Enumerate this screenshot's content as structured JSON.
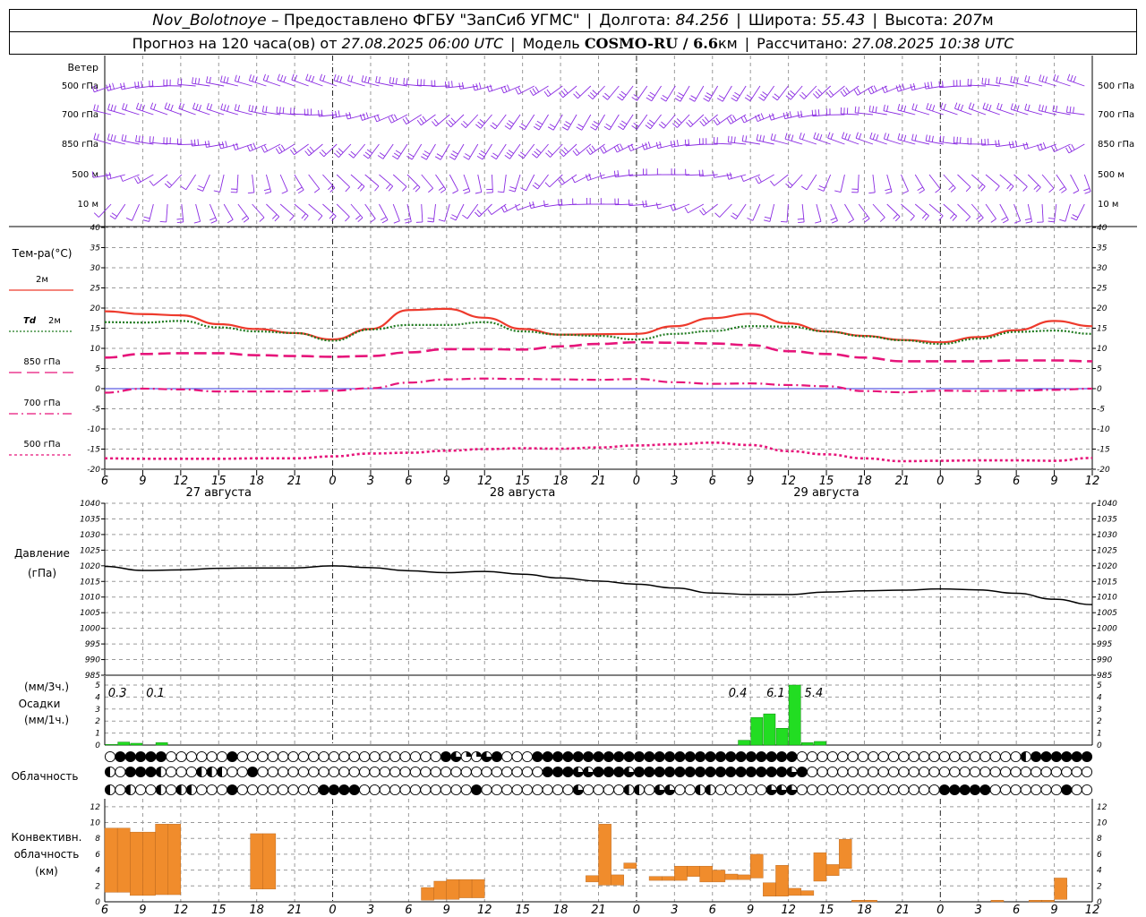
{
  "header": {
    "station": "Nov_Bolotnoye",
    "provider": "– Предоставлено ФГБУ \"ЗапСиб УГМС\"",
    "lon_label": "Долгота:",
    "lon_value": "84.256",
    "lat_label": "Широта:",
    "lat_value": "55.43",
    "alt_label": "Высота:",
    "alt_value": "207",
    "alt_unit": "м",
    "forecast_prefix": "Прогноз на 120 часа(ов) от",
    "forecast_time": "27.08.2025 06:00 UTC",
    "model_label": "Модель",
    "model_name": "COSMO-RU / 6.6",
    "model_unit": "км",
    "calc_label": "Рассчитано:",
    "calc_time": "27.08.2025 10:38 UTC"
  },
  "colors": {
    "wind": "#8a2be2",
    "t2m": "#ee3a2c",
    "td2m": "#1e7a1e",
    "t850": "#e6157a",
    "t700": "#e6157a",
    "t500": "#e6157a",
    "pressure": "#000000",
    "precip": "#22dd22",
    "convective": "#f08c2c",
    "grid": "#9a9a9a",
    "zero_line": "#3333dd"
  },
  "chart_data": [
    {
      "type": "wind_barbs",
      "panel_label": "Ветер",
      "levels": [
        "500 гПа",
        "700 гПа",
        "850 гПа",
        "500 м",
        "10 м"
      ]
    },
    {
      "type": "line",
      "panel_label": "Тем-ра(°C)",
      "ylim": [
        -20,
        40
      ],
      "yticks": [
        -20,
        -15,
        -10,
        -5,
        0,
        5,
        10,
        15,
        20,
        25,
        30,
        35,
        40
      ],
      "x_ticks": [
        "6",
        "9",
        "12",
        "15",
        "18",
        "21",
        "0",
        "3",
        "6",
        "9",
        "12",
        "15",
        "18",
        "21",
        "0",
        "3",
        "6",
        "9",
        "12",
        "15",
        "18",
        "21",
        "0",
        "3",
        "6",
        "9",
        "12"
      ],
      "dates": [
        "27 августа",
        "28 августа",
        "29 августа"
      ],
      "x_hours": [
        0,
        3,
        6,
        9,
        12,
        15,
        18,
        21,
        24,
        27,
        30,
        33,
        36,
        39,
        42,
        45,
        48,
        51,
        54,
        57,
        60,
        63,
        66,
        69,
        72,
        75,
        78
      ],
      "series": [
        {
          "name": "2м",
          "legend_prefix": "",
          "style": "solid",
          "values": [
            19.2,
            18.5,
            18.2,
            16,
            14.8,
            13.8,
            12.2,
            14.8,
            19.5,
            19.8,
            17.6,
            14.8,
            13.4,
            13.5,
            13.6,
            15.5,
            17.5,
            18.6,
            16.2,
            14.2,
            13.1,
            12.1,
            11.5,
            12.8,
            14.5,
            16.8,
            15.5
          ]
        },
        {
          "name": "2м",
          "legend_prefix": "Td",
          "style": "dotted",
          "values": [
            16.5,
            16.4,
            16.8,
            15.2,
            14.2,
            13.8,
            11.9,
            14.7,
            15.8,
            15.8,
            16.5,
            14.2,
            13.4,
            13.1,
            12.2,
            13.6,
            14.3,
            15.5,
            15.4,
            14.2,
            13,
            12,
            11.1,
            12.4,
            14.1,
            14.4,
            13.6
          ]
        },
        {
          "name": "850 гПа",
          "legend_prefix": "",
          "style": "dashed",
          "values": [
            7.7,
            8.6,
            8.8,
            8.8,
            8.3,
            8.1,
            7.9,
            8.1,
            9,
            9.8,
            9.8,
            9.7,
            10.5,
            11.1,
            11.5,
            11.4,
            11.2,
            10.8,
            9.3,
            8.6,
            7.7,
            6.8,
            6.8,
            6.8,
            7,
            7,
            6.8
          ]
        },
        {
          "name": "700 гПа",
          "legend_prefix": "",
          "style": "dashdot",
          "values": [
            -1,
            0,
            -0.2,
            -0.7,
            -0.7,
            -0.7,
            -0.5,
            0.1,
            1.5,
            2.3,
            2.5,
            2.4,
            2.3,
            2.2,
            2.4,
            1.6,
            1.2,
            1.3,
            0.9,
            0.6,
            -0.6,
            -0.9,
            -0.5,
            -0.6,
            -0.5,
            -0.3,
            0
          ]
        },
        {
          "name": "500 гПа",
          "legend_prefix": "",
          "style": "dotted-fine",
          "values": [
            -17.3,
            -17.4,
            -17.4,
            -17.4,
            -17.3,
            -17.3,
            -16.8,
            -16.1,
            -15.9,
            -15.4,
            -15,
            -14.8,
            -14.9,
            -14.6,
            -14.1,
            -13.8,
            -13.4,
            -14,
            -15.5,
            -16.3,
            -17.3,
            -18,
            -17.9,
            -17.8,
            -17.8,
            -17.9,
            -17.2
          ]
        }
      ]
    },
    {
      "type": "line",
      "panel_label": "Давление",
      "panel_unit": "(гПа)",
      "ylim": [
        985,
        1040
      ],
      "yticks": [
        985,
        990,
        995,
        1000,
        1005,
        1010,
        1015,
        1020,
        1025,
        1030,
        1035,
        1040
      ],
      "x_hours": [
        0,
        3,
        6,
        9,
        12,
        15,
        18,
        21,
        24,
        27,
        30,
        33,
        36,
        39,
        42,
        45,
        48,
        51,
        54,
        57,
        60,
        63,
        66,
        69,
        72,
        75,
        78
      ],
      "series": [
        {
          "name": "",
          "values": [
            1019.8,
            1018.5,
            1018.7,
            1019.2,
            1019.3,
            1019.3,
            1020,
            1019.4,
            1018.4,
            1017.8,
            1018.2,
            1017.3,
            1016.1,
            1015.1,
            1014.1,
            1012.9,
            1011.3,
            1010.8,
            1010.8,
            1011.6,
            1012,
            1012.2,
            1012.6,
            1012.3,
            1011.2,
            1009.3,
            1007.6
          ]
        }
      ]
    },
    {
      "type": "bar",
      "panel_label": "Осадки",
      "units_top": "(мм/3ч.)",
      "units_bottom": "(мм/1ч.)",
      "ylim": [
        0,
        5
      ],
      "yticks": [
        0,
        1,
        2,
        3,
        4,
        5
      ],
      "bars": [
        {
          "h": 1,
          "v": 0.05
        },
        {
          "h": 2,
          "v": 0.25
        },
        {
          "h": 3,
          "v": 0.15
        },
        {
          "h": 5,
          "v": 0.2
        },
        {
          "h": 51,
          "v": 0.4
        },
        {
          "h": 52,
          "v": 2.3
        },
        {
          "h": 53,
          "v": 2.6
        },
        {
          "h": 54,
          "v": 1.4
        },
        {
          "h": 55,
          "v": 5.0
        },
        {
          "h": 56,
          "v": 0.2
        },
        {
          "h": 57,
          "v": 0.3
        }
      ],
      "totals": [
        {
          "h": 1.5,
          "text": "0.3"
        },
        {
          "h": 4.5,
          "text": "0.1"
        },
        {
          "h": 50.5,
          "text": "0.4"
        },
        {
          "h": 53.5,
          "text": "6.1"
        },
        {
          "h": 56.5,
          "text": "5.4"
        }
      ]
    },
    {
      "type": "cloud_symbols",
      "panel_label": "Облачность",
      "rows": [
        "0444440000004000000000000000000004311340004444444444444444444444444400000000000000000000002444444",
        "2044420002220040000000000000000000000000000444334443444444444444444340000000000000000000000000000",
        "2020020220004000000004444000000000004000000000300002203300220000033300000000000000444440000000400"
      ]
    },
    {
      "type": "range_bar",
      "panel_label": "Конвективн. облачность (км)",
      "ylim": [
        0,
        13
      ],
      "yticks": [
        0,
        2,
        4,
        6,
        8,
        10,
        12
      ],
      "bars": [
        {
          "h": 0.5,
          "lo": 1.2,
          "hi": 9.3
        },
        {
          "h": 1.5,
          "lo": 1.2,
          "hi": 9.3
        },
        {
          "h": 2.5,
          "lo": 0.8,
          "hi": 8.8
        },
        {
          "h": 3.5,
          "lo": 0.8,
          "hi": 8.8
        },
        {
          "h": 4.5,
          "lo": 0.9,
          "hi": 9.8
        },
        {
          "h": 5.5,
          "lo": 0.9,
          "hi": 9.8
        },
        {
          "h": 12,
          "lo": 1.6,
          "hi": 8.6
        },
        {
          "h": 13,
          "lo": 1.6,
          "hi": 8.6
        },
        {
          "h": 25.5,
          "lo": 0.2,
          "hi": 1.8
        },
        {
          "h": 26.5,
          "lo": 0.3,
          "hi": 2.6
        },
        {
          "h": 27.5,
          "lo": 0.3,
          "hi": 2.8
        },
        {
          "h": 28.5,
          "lo": 0.5,
          "hi": 2.8
        },
        {
          "h": 29.5,
          "lo": 0.5,
          "hi": 2.8
        },
        {
          "h": 38.5,
          "lo": 2.5,
          "hi": 3.3
        },
        {
          "h": 39.5,
          "lo": 2.1,
          "hi": 9.8
        },
        {
          "h": 40.5,
          "lo": 2.1,
          "hi": 3.4
        },
        {
          "h": 41.5,
          "lo": 4.2,
          "hi": 4.9
        },
        {
          "h": 43.5,
          "lo": 2.7,
          "hi": 3.2
        },
        {
          "h": 44.5,
          "lo": 2.7,
          "hi": 3.2
        },
        {
          "h": 45.5,
          "lo": 2.7,
          "hi": 4.5
        },
        {
          "h": 46.5,
          "lo": 3.2,
          "hi": 4.5
        },
        {
          "h": 47.5,
          "lo": 2.5,
          "hi": 4.5
        },
        {
          "h": 48.5,
          "lo": 2.5,
          "hi": 4.0
        },
        {
          "h": 49.5,
          "lo": 2.8,
          "hi": 3.5
        },
        {
          "h": 50.5,
          "lo": 2.8,
          "hi": 3.4
        },
        {
          "h": 51.5,
          "lo": 3.0,
          "hi": 6.0
        },
        {
          "h": 52.5,
          "lo": 0.7,
          "hi": 2.4
        },
        {
          "h": 53.5,
          "lo": 0.7,
          "hi": 4.6
        },
        {
          "h": 54.5,
          "lo": 0.8,
          "hi": 1.7
        },
        {
          "h": 55.5,
          "lo": 0.8,
          "hi": 1.4
        },
        {
          "h": 56.5,
          "lo": 2.6,
          "hi": 6.2
        },
        {
          "h": 57.5,
          "lo": 3.3,
          "hi": 4.7
        },
        {
          "h": 58.5,
          "lo": 4.2,
          "hi": 7.9
        },
        {
          "h": 59.5,
          "lo": 0.0,
          "hi": 0.2
        },
        {
          "h": 60.5,
          "lo": 0.0,
          "hi": 0.2
        },
        {
          "h": 70.5,
          "lo": 0.0,
          "hi": 0.2
        },
        {
          "h": 73.5,
          "lo": 0.0,
          "hi": 0.2
        },
        {
          "h": 74.5,
          "lo": 0.0,
          "hi": 0.2
        },
        {
          "h": 75.5,
          "lo": 0.3,
          "hi": 3.0
        }
      ]
    }
  ]
}
